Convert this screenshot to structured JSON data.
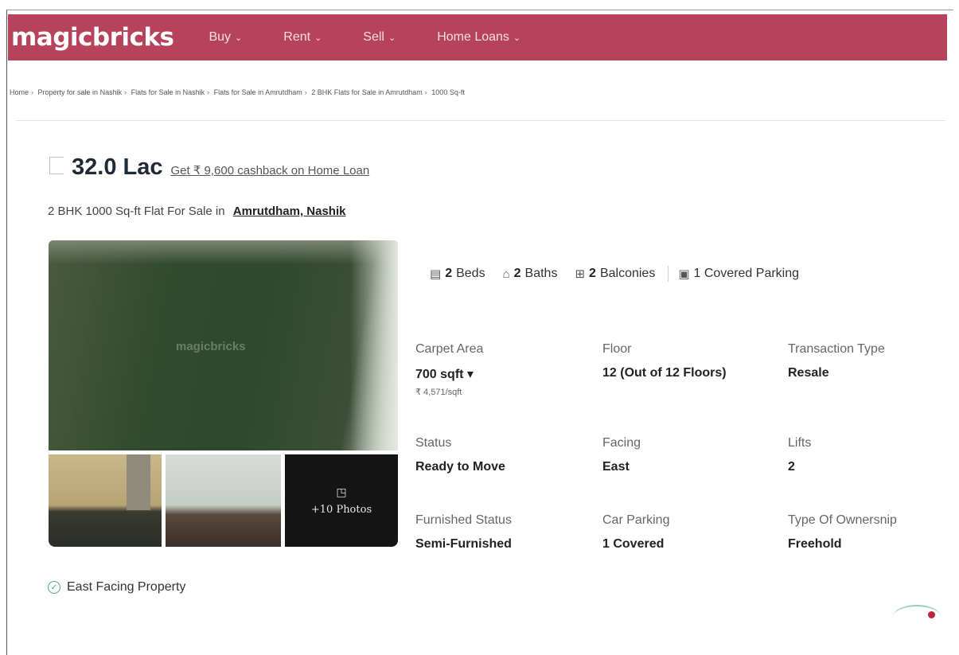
{
  "header": {
    "logo": "magicbricks",
    "nav": [
      {
        "label": "Buy"
      },
      {
        "label": "Rent"
      },
      {
        "label": "Sell"
      },
      {
        "label": "Home Loans"
      }
    ]
  },
  "breadcrumb": [
    "Home",
    "Property for sale in Nashik",
    "Flats for Sale in Nashik",
    "Flats for Sale in Amrutdham",
    "2 BHK Flats for Sale in Amrutdham",
    "1000 Sq-ft"
  ],
  "listing": {
    "price": "32.0 Lac",
    "cashback": "Get ₹ 9,600 cashback on Home Loan",
    "title_prefix": "2 BHK 1000 Sq-ft Flat For Sale in",
    "location": "Amrutdham, Nashik",
    "photo_watermark": "magicbricks",
    "more_photos": "+10 Photos"
  },
  "amenities": {
    "beds_count": "2",
    "beds_label": "Beds",
    "baths_count": "2",
    "baths_label": "Baths",
    "balconies_count": "2",
    "balconies_label": "Balconies",
    "parking": "1 Covered Parking"
  },
  "details": {
    "carpet_area": {
      "label": "Carpet Area",
      "value": "700 sqft ▾",
      "sub": "₹ 4,571/sqft"
    },
    "floor": {
      "label": "Floor",
      "value": "12 (Out of 12 Floors)"
    },
    "transaction_type": {
      "label": "Transaction Type",
      "value": "Resale"
    },
    "status": {
      "label": "Status",
      "value": "Ready to Move"
    },
    "facing": {
      "label": "Facing",
      "value": "East"
    },
    "lifts": {
      "label": "Lifts",
      "value": "2"
    },
    "furnished_status": {
      "label": "Furnished Status",
      "value": "Semi-Furnished"
    },
    "car_parking": {
      "label": "Car Parking",
      "value": "1 Covered"
    },
    "ownership": {
      "label": "Type Of Ownersnip",
      "value": "Freehold"
    }
  },
  "features": {
    "highlight": "East Facing Property"
  },
  "colors": {
    "navbar": "#b7425c",
    "check": "#49a58c",
    "chat_dot": "#c0223a"
  }
}
